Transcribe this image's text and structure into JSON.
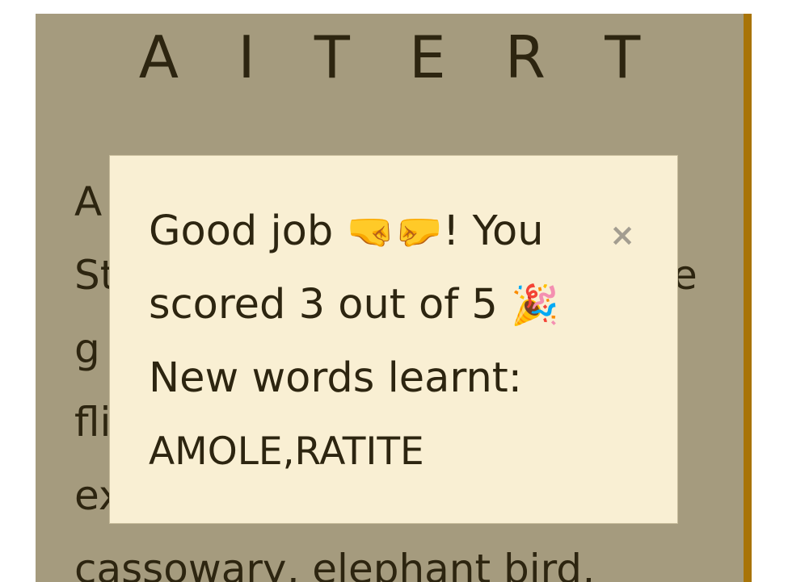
{
  "game": {
    "scrambled_letters": "A I T E R T",
    "definition_lines": [
      "A",
      "St",
      "g",
      "fli",
      "ex",
      "cassowary, elephant bird,"
    ],
    "definition_line_2_suffix": "e"
  },
  "result_modal": {
    "line1_prefix": "Good job ",
    "line1_emoji": "🤜🤛",
    "line1_suffix": "! You",
    "line2_text": "scored 3 out of 5 ",
    "line2_emoji": "🎉",
    "line3": "New words learnt:",
    "words_learnt": "AMOLE,RATITE",
    "close_symbol": "×"
  },
  "colors": {
    "panel_background": "#a59b7e",
    "accent_bar": "#a87408",
    "modal_background": "#f9efd3",
    "text": "#2d2510"
  }
}
